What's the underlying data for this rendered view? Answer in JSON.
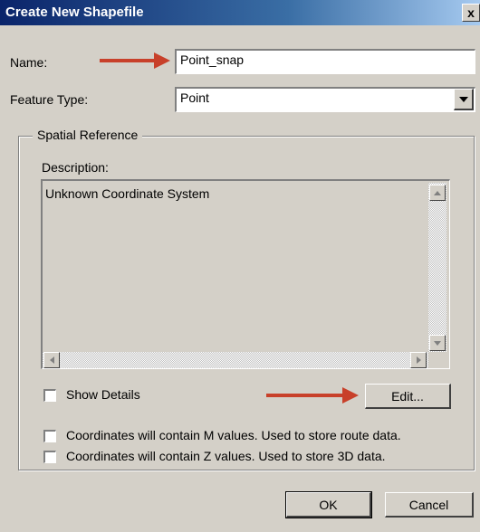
{
  "window": {
    "title": "Create New Shapefile",
    "close_glyph": "x"
  },
  "name_field": {
    "label": "Name:",
    "value": "Point_snap"
  },
  "feature_type": {
    "label": "Feature Type:",
    "value": "Point"
  },
  "spatial_reference": {
    "group_title": "Spatial Reference",
    "description_label": "Description:",
    "description_text": "Unknown Coordinate System",
    "show_details_label": "Show Details",
    "edit_button_label": "Edit..."
  },
  "options": {
    "m_values_label": "Coordinates will contain M values. Used to store route data.",
    "z_values_label": "Coordinates will contain Z values. Used to store 3D data."
  },
  "buttons": {
    "ok": "OK",
    "cancel": "Cancel"
  },
  "colors": {
    "annotation_arrow": "#c8402a",
    "title_bar": "#0a246a",
    "dialog_bg": "#d4d0c8"
  }
}
